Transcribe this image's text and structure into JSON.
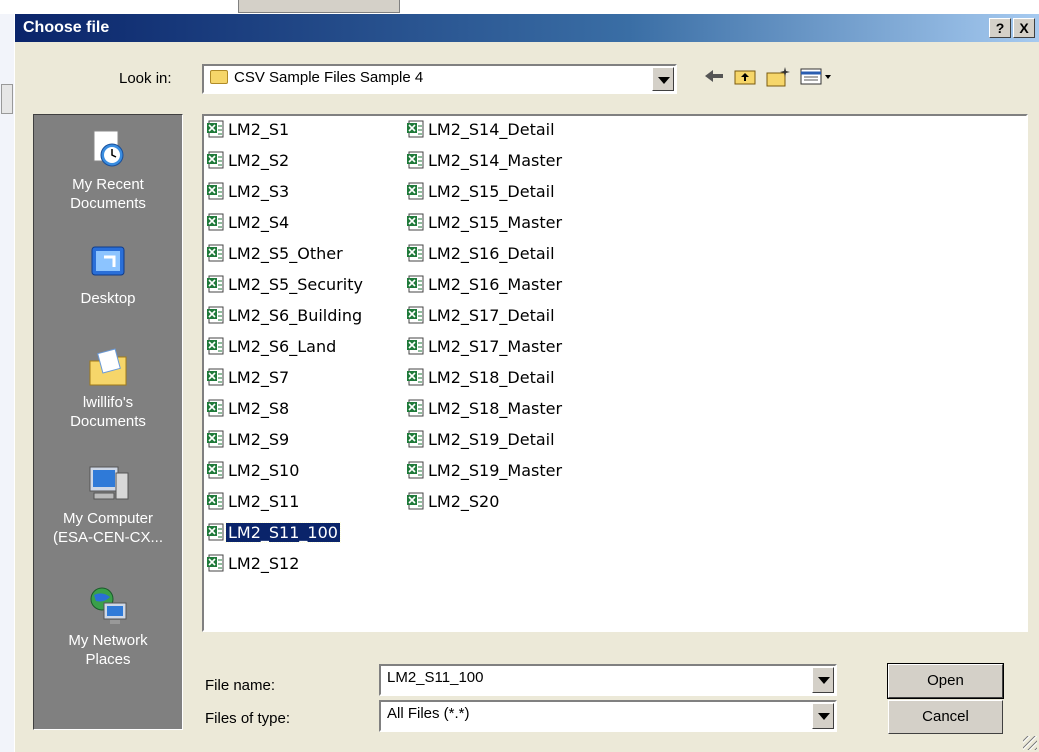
{
  "dialog": {
    "title": "Choose file",
    "help_label": "?",
    "close_label": "X"
  },
  "lookin": {
    "label": "Look in:",
    "value": "CSV Sample Files Sample 4"
  },
  "toolbar": {
    "back_icon": "back-arrow-icon",
    "up_icon": "up-folder-icon",
    "new_folder_icon": "new-folder-icon",
    "views_icon": "views-menu-icon"
  },
  "places": [
    {
      "label": "My Recent\nDocuments",
      "icon": "recent-documents-icon"
    },
    {
      "label": "Desktop",
      "icon": "desktop-icon"
    },
    {
      "label": "lwillifo's\nDocuments",
      "icon": "my-documents-icon"
    },
    {
      "label": "My Computer\n(ESA-CEN-CX...",
      "icon": "my-computer-icon"
    },
    {
      "label": "My Network\nPlaces",
      "icon": "network-places-icon"
    }
  ],
  "files": {
    "col1": [
      "LM2_S1",
      "LM2_S2",
      "LM2_S3",
      "LM2_S4",
      "LM2_S5_Other",
      "LM2_S5_Security",
      "LM2_S6_Building",
      "LM2_S6_Land",
      "LM2_S7",
      "LM2_S8",
      "LM2_S9",
      "LM2_S10",
      "LM2_S11",
      "LM2_S11_100",
      "LM2_S12"
    ],
    "col2": [
      "LM2_S14_Detail",
      "LM2_S14_Master",
      "LM2_S15_Detail",
      "LM2_S15_Master",
      "LM2_S16_Detail",
      "LM2_S16_Master",
      "LM2_S17_Detail",
      "LM2_S17_Master",
      "LM2_S18_Detail",
      "LM2_S18_Master",
      "LM2_S19_Detail",
      "LM2_S19_Master",
      "LM2_S20"
    ],
    "selected": "LM2_S11_100"
  },
  "filename": {
    "label": "File name:",
    "value": "LM2_S11_100"
  },
  "filetype": {
    "label": "Files of type:",
    "value": "All Files (*.*)"
  },
  "buttons": {
    "open": "Open",
    "cancel": "Cancel"
  }
}
